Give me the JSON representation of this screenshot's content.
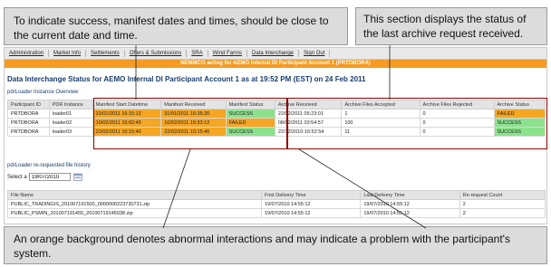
{
  "callouts": {
    "top_left": "To indicate success, manifest dates and times, should be close to the current date and time.",
    "top_right": "This section displays the status of the last archive request received.",
    "bottom": "An orange background denotes abnormal interactions and may indicate a problem with the participant's system."
  },
  "nav": {
    "items": [
      "Administration",
      "Market Info",
      "Settlements",
      "Offers & Submissions",
      "SRA",
      "Wind Farms",
      "Data Interchange",
      "Sign Out"
    ]
  },
  "banner": "NEMMCO acting for AEMO Internal DI Participant Account 1 (PRTDBORA)",
  "page_title": "Data Interchange Status for AEMO Internal DI Participant Account 1 as at 19:52 PM (EST) on 24 Feb 2011",
  "section1_title": "pdrLoader Instance Overview",
  "instances": {
    "headers": [
      "Participant ID",
      "PDR Instance",
      "Manifest Start Datetime",
      "Manifest Received",
      "Manifest Status",
      "Archive Received",
      "Archive Files Accepted",
      "Archive Files Rejected",
      "Archive Status"
    ],
    "rows": [
      [
        "PRTDBORA",
        "loader01",
        "31/01/2011 16:15:12",
        "31/01/2011 16:35:20",
        "SUCCESS",
        "22/02/2011 05:23:01",
        "1",
        "0",
        "FAILED"
      ],
      [
        "PRTDBORA",
        "loader02",
        "10/02/2011 15:02:49",
        "10/02/2011 15:33:12",
        "FAILED",
        "08/02/2011 03:54:57",
        "100",
        "0",
        "SUCCESS"
      ],
      [
        "PRTDBORA",
        "loader03",
        "22/02/2011 10:15:40",
        "22/02/2011 10:15:40",
        "SUCCESS",
        "22/12/2010 16:52:54",
        "11",
        "0",
        "SUCCESS"
      ]
    ],
    "row_colors": [
      [
        "",
        "",
        "orange",
        "orange",
        "green",
        "",
        "",
        "",
        "orange"
      ],
      [
        "",
        "",
        "orange",
        "orange",
        "orange",
        "",
        "",
        "",
        "green"
      ],
      [
        "",
        "",
        "orange",
        "orange",
        "green",
        "",
        "",
        "",
        "green"
      ]
    ]
  },
  "section2_title": "pdrLoader re-requested file history",
  "date_filter": {
    "label": "Select a Date",
    "value": "19/07/2010"
  },
  "history": {
    "headers": [
      "File Name",
      "First Delivery Time",
      "Last Delivery Time",
      "Re-request Count"
    ],
    "rows": [
      [
        "PUBLIC_TRADINGIS_201007191500_0000000223730731.zip",
        "19/07/2010 14:55:12",
        "19/07/2010 14:55:12",
        "2"
      ],
      [
        "PUBLIC_PSMIN_201007191455_20100719145038.zip",
        "19/07/2010 14:55:12",
        "19/07/2010 14:55:12",
        "2"
      ]
    ]
  },
  "colors": {
    "orange": "#f5a623",
    "green": "#8ce28c",
    "banner": "#f59a23",
    "highlight_border": "#8b0000"
  }
}
